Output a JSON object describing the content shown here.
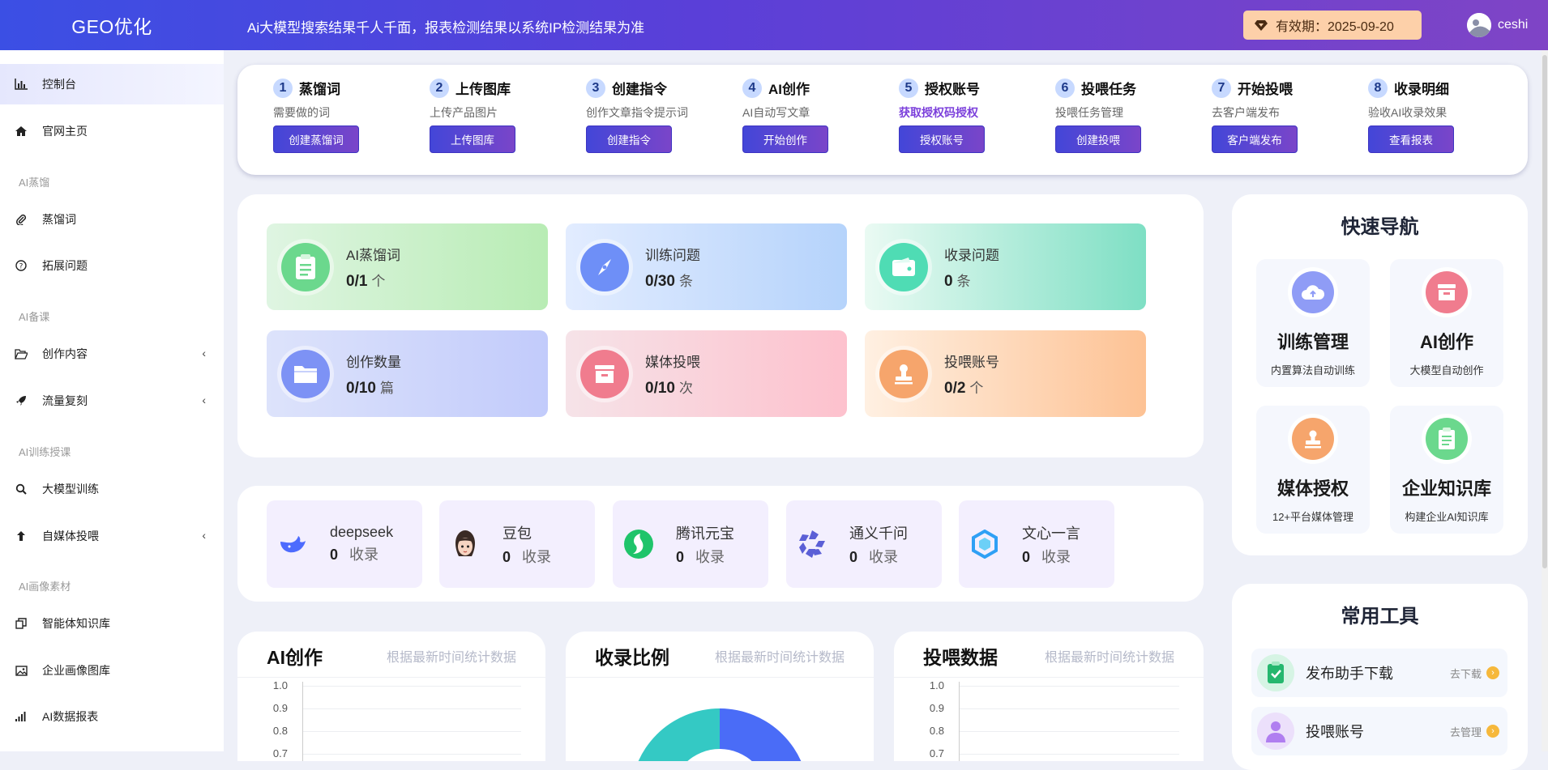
{
  "header": {
    "logo": "GEO优化",
    "notice": "Ai大模型搜索结果千人千面，报表检测结果以系统IP检测结果为准",
    "validity_label": "有效期：2025-09-20",
    "username": "ceshi"
  },
  "sidebar": {
    "items": [
      {
        "label": "控制台",
        "icon": "bar-chart-icon"
      },
      {
        "label": "官网主页",
        "icon": "home-icon"
      },
      {
        "label": "蒸馏词",
        "icon": "paperclip-icon"
      },
      {
        "label": "拓展问题",
        "icon": "question-circle-icon"
      },
      {
        "label": "创作内容",
        "icon": "folder-open-icon"
      },
      {
        "label": "流量复刻",
        "icon": "rocket-icon"
      },
      {
        "label": "大模型训练",
        "icon": "search-icon"
      },
      {
        "label": "自媒体投喂",
        "icon": "arrow-up-icon"
      },
      {
        "label": "智能体知识库",
        "icon": "copy-icon"
      },
      {
        "label": "企业画像图库",
        "icon": "image-icon"
      },
      {
        "label": "AI数据报表",
        "icon": "signal-icon"
      }
    ],
    "groups": [
      "AI蒸馏",
      "AI备课",
      "AI训练授课",
      "AI画像素材"
    ],
    "arrow": "‹"
  },
  "steps": [
    {
      "num": "1",
      "title": "蒸馏词",
      "sub": "需要做的词",
      "button": "创建蒸馏词"
    },
    {
      "num": "2",
      "title": "上传图库",
      "sub": "上传产品图片",
      "button": "上传图库"
    },
    {
      "num": "3",
      "title": "创建指令",
      "sub": "创作文章指令提示词",
      "button": "创建指令"
    },
    {
      "num": "4",
      "title": "AI创作",
      "sub": "AI自动写文章",
      "button": "开始创作"
    },
    {
      "num": "5",
      "title": "授权账号",
      "sub": "获取授权码授权",
      "button": "授权账号"
    },
    {
      "num": "6",
      "title": "投喂任务",
      "sub": "投喂任务管理",
      "button": "创建投喂"
    },
    {
      "num": "7",
      "title": "开始投喂",
      "sub": "去客户端发布",
      "button": "客户端发布"
    },
    {
      "num": "8",
      "title": "收录明细",
      "sub": "验收AI收录效果",
      "button": "查看报表"
    }
  ],
  "stats": [
    {
      "label": "AI蒸馏词",
      "value": "0/1",
      "unit": "个",
      "icon": "clipboard-icon"
    },
    {
      "label": "训练问题",
      "value": "0/30",
      "unit": "条",
      "icon": "compass-icon"
    },
    {
      "label": "收录问题",
      "value": "0",
      "unit": "条",
      "icon": "wallet-icon"
    },
    {
      "label": "创作数量",
      "value": "0/10",
      "unit": "篇",
      "icon": "folder-icon"
    },
    {
      "label": "媒体投喂",
      "value": "0/10",
      "unit": "次",
      "icon": "inbox-icon"
    },
    {
      "label": "投喂账号",
      "value": "0/2",
      "unit": "个",
      "icon": "stamp-icon"
    }
  ],
  "ai_platforms": [
    {
      "name": "deepseek",
      "count": "0",
      "unit": "收录",
      "icon": "deepseek-logo-icon"
    },
    {
      "name": "豆包",
      "count": "0",
      "unit": "收录",
      "icon": "doubao-logo-icon"
    },
    {
      "name": "腾讯元宝",
      "count": "0",
      "unit": "收录",
      "icon": "yuanbao-logo-icon"
    },
    {
      "name": "通义千问",
      "count": "0",
      "unit": "收录",
      "icon": "qianwen-logo-icon"
    },
    {
      "name": "文心一言",
      "count": "0",
      "unit": "收录",
      "icon": "wenxin-logo-icon"
    }
  ],
  "quick_nav": {
    "title": "快速导航",
    "items": [
      {
        "name": "训练管理",
        "sub": "内置算法自动训练",
        "icon": "cloud-icon"
      },
      {
        "name": "AI创作",
        "sub": "大模型自动创作",
        "icon": "inbox-icon"
      },
      {
        "name": "媒体授权",
        "sub": "12+平台媒体管理",
        "icon": "stamp-icon"
      },
      {
        "name": "企业知识库",
        "sub": "构建企业AI知识库",
        "icon": "clipboard-icon"
      }
    ]
  },
  "tools": {
    "title": "常用工具",
    "items": [
      {
        "name": "发布助手下载",
        "action": "去下载",
        "icon": "clipboard-check-icon"
      },
      {
        "name": "投喂账号",
        "action": "去管理",
        "icon": "user-icon"
      }
    ]
  },
  "charts": [
    {
      "title": "AI创作",
      "subtitle": "根据最新时间统计数据",
      "yticks": [
        "1.0",
        "0.9",
        "0.8",
        "0.7"
      ]
    },
    {
      "title": "收录比例",
      "subtitle": "根据最新时间统计数据"
    },
    {
      "title": "投喂数据",
      "subtitle": "根据最新时间统计数据",
      "yticks": [
        "1.0",
        "0.9",
        "0.8",
        "0.7"
      ]
    }
  ],
  "chart_data": [
    {
      "type": "line",
      "ylim": [
        0,
        1.0
      ],
      "yticks": [
        1.0,
        0.9,
        0.8,
        0.7
      ],
      "grid": true
    },
    {
      "type": "pie",
      "colors": [
        "#4a6cf7",
        "#34c9c4"
      ]
    },
    {
      "type": "line",
      "ylim": [
        0,
        1.0
      ],
      "yticks": [
        1.0,
        0.9,
        0.8,
        0.7
      ],
      "grid": true
    }
  ],
  "colors": {
    "accent": "#4346d8",
    "brand_gradient_end": "#7f44c6",
    "highlight": "#7b3fdb"
  }
}
